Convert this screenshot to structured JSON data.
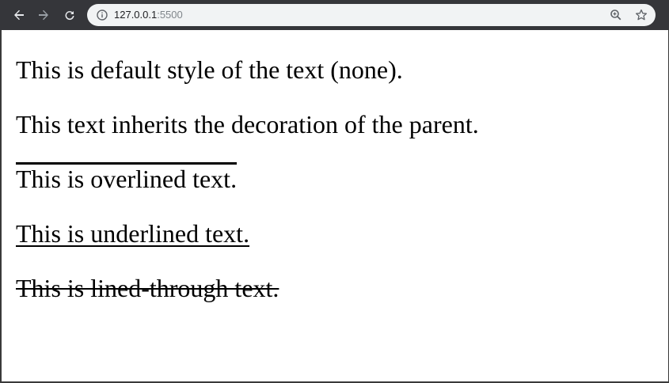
{
  "browser": {
    "url_host": "127.0.0.1",
    "url_port": ":5500",
    "icons": [
      "back-arrow-icon",
      "forward-arrow-icon",
      "reload-icon",
      "info-icon",
      "zoom-icon",
      "bookmark-star-icon"
    ]
  },
  "content": {
    "paragraphs": [
      "This is default style of the text (none).",
      "This text inherits the decoration of the parent.",
      "This is overlined text.",
      "This is underlined text.",
      "This is lined-through text."
    ]
  }
}
